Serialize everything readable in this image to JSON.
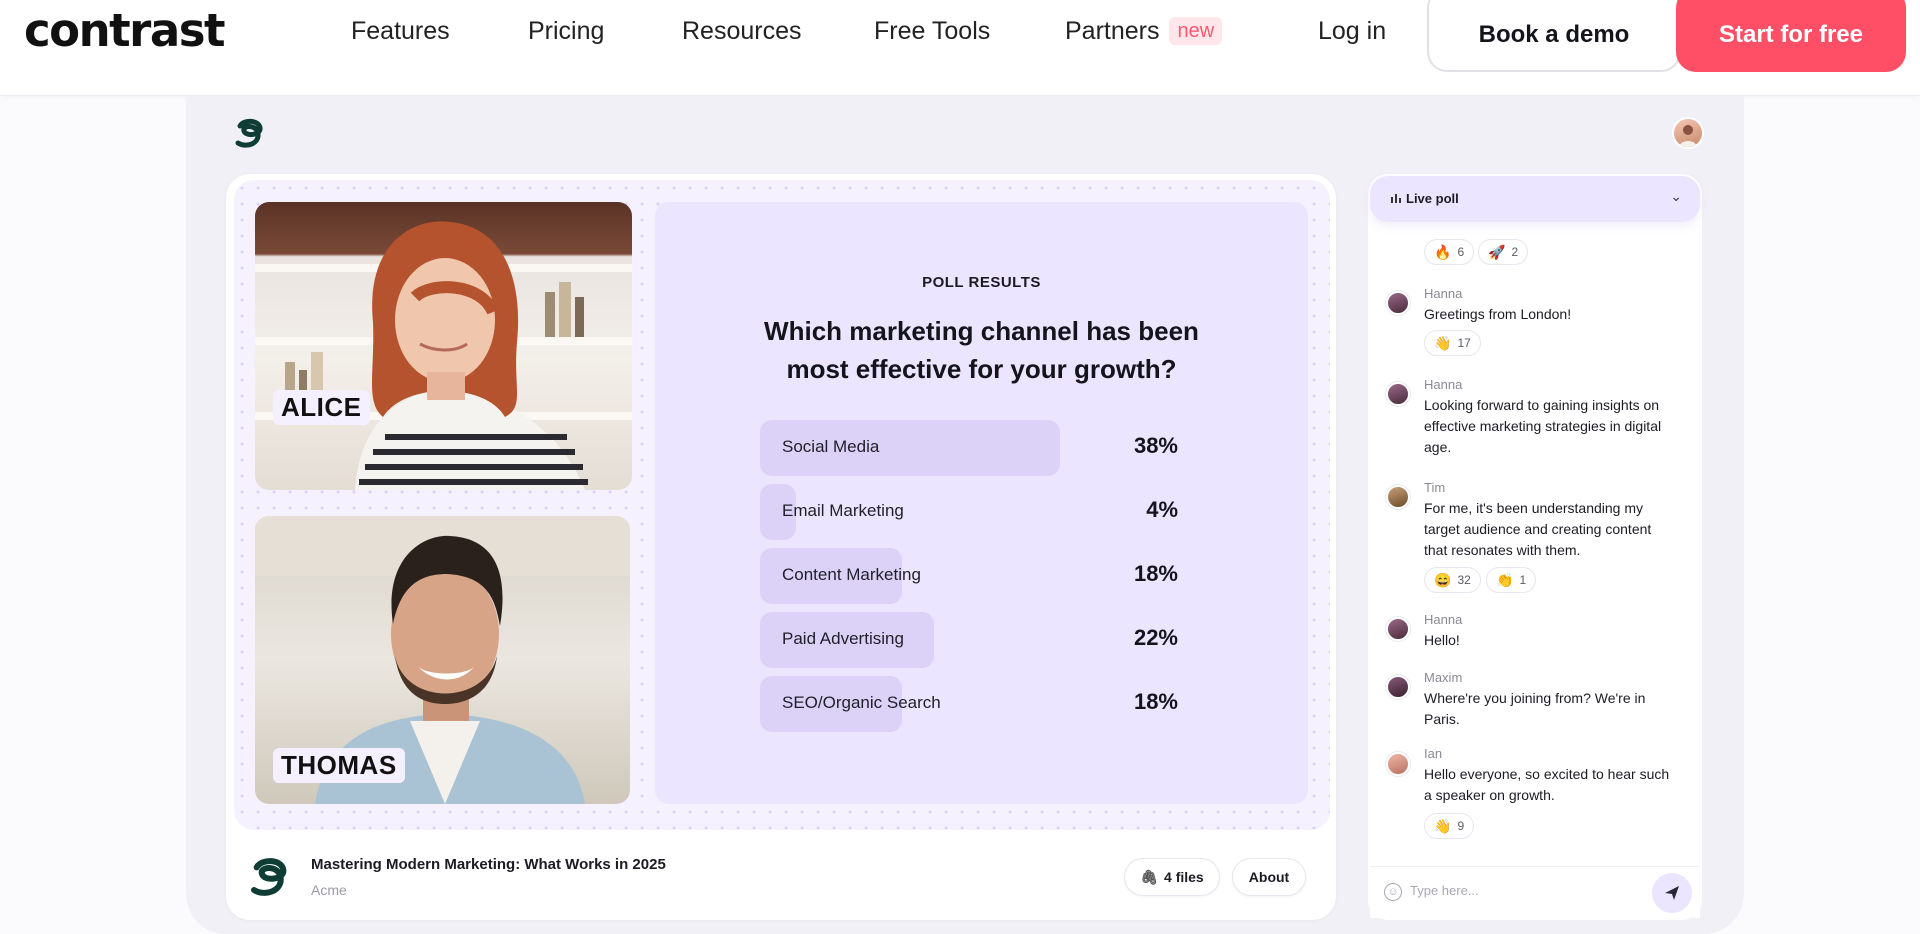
{
  "nav": {
    "logo": "contrast",
    "links": [
      "Features",
      "Pricing",
      "Resources",
      "Free Tools",
      "Partners"
    ],
    "partners_badge": "new",
    "login": "Log in",
    "book_demo": "Book a demo",
    "start_free": "Start for free"
  },
  "stage": {
    "speakers": [
      "ALICE",
      "THOMAS"
    ],
    "poll": {
      "heading": "POLL RESULTS",
      "question_line1": "Which marketing channel has been",
      "question_line2": "most effective for your growth?",
      "options": [
        {
          "label": "Social Media",
          "percent": "38%",
          "value": 38
        },
        {
          "label": "Email Marketing",
          "percent": "4%",
          "value": 4
        },
        {
          "label": "Content Marketing",
          "percent": "18%",
          "value": 18
        },
        {
          "label": "Paid Advertising",
          "percent": "22%",
          "value": 22
        },
        {
          "label": "SEO/Organic Search",
          "percent": "18%",
          "value": 18
        }
      ]
    }
  },
  "session": {
    "title": "Mastering Modern Marketing: What Works in 2025",
    "organizer": "Acme",
    "files_label": "4 files",
    "about_label": "About"
  },
  "chat": {
    "header": "Live poll",
    "top_reactions": [
      {
        "emoji": "🔥",
        "count": "6"
      },
      {
        "emoji": "🚀",
        "count": "2"
      }
    ],
    "messages": [
      {
        "name": "Hanna",
        "text": "Greetings from London!",
        "reactions": [
          {
            "emoji": "👋",
            "count": "17"
          }
        ]
      },
      {
        "name": "Hanna",
        "text": "Looking forward to gaining insights on effective marketing strategies in digital age.",
        "reactions": []
      },
      {
        "name": "Tim",
        "text": "For me, it's been understanding my target audience and creating content that resonates with them.",
        "reactions": [
          {
            "emoji": "😄",
            "count": "32"
          },
          {
            "emoji": "👏",
            "count": "1"
          }
        ]
      },
      {
        "name": "Hanna",
        "text": "Hello!",
        "reactions": []
      },
      {
        "name": "Maxim",
        "text": "Where're you joining from? We're in Paris.",
        "reactions": []
      },
      {
        "name": "Ian",
        "text": "Hello everyone, so excited to hear such a speaker on growth.",
        "reactions": [
          {
            "emoji": "👋",
            "count": "9"
          }
        ]
      }
    ],
    "input_placeholder": "Type here...",
    "colors": {
      "accent": "#ece5ff",
      "brand": "#ff4f66"
    }
  }
}
